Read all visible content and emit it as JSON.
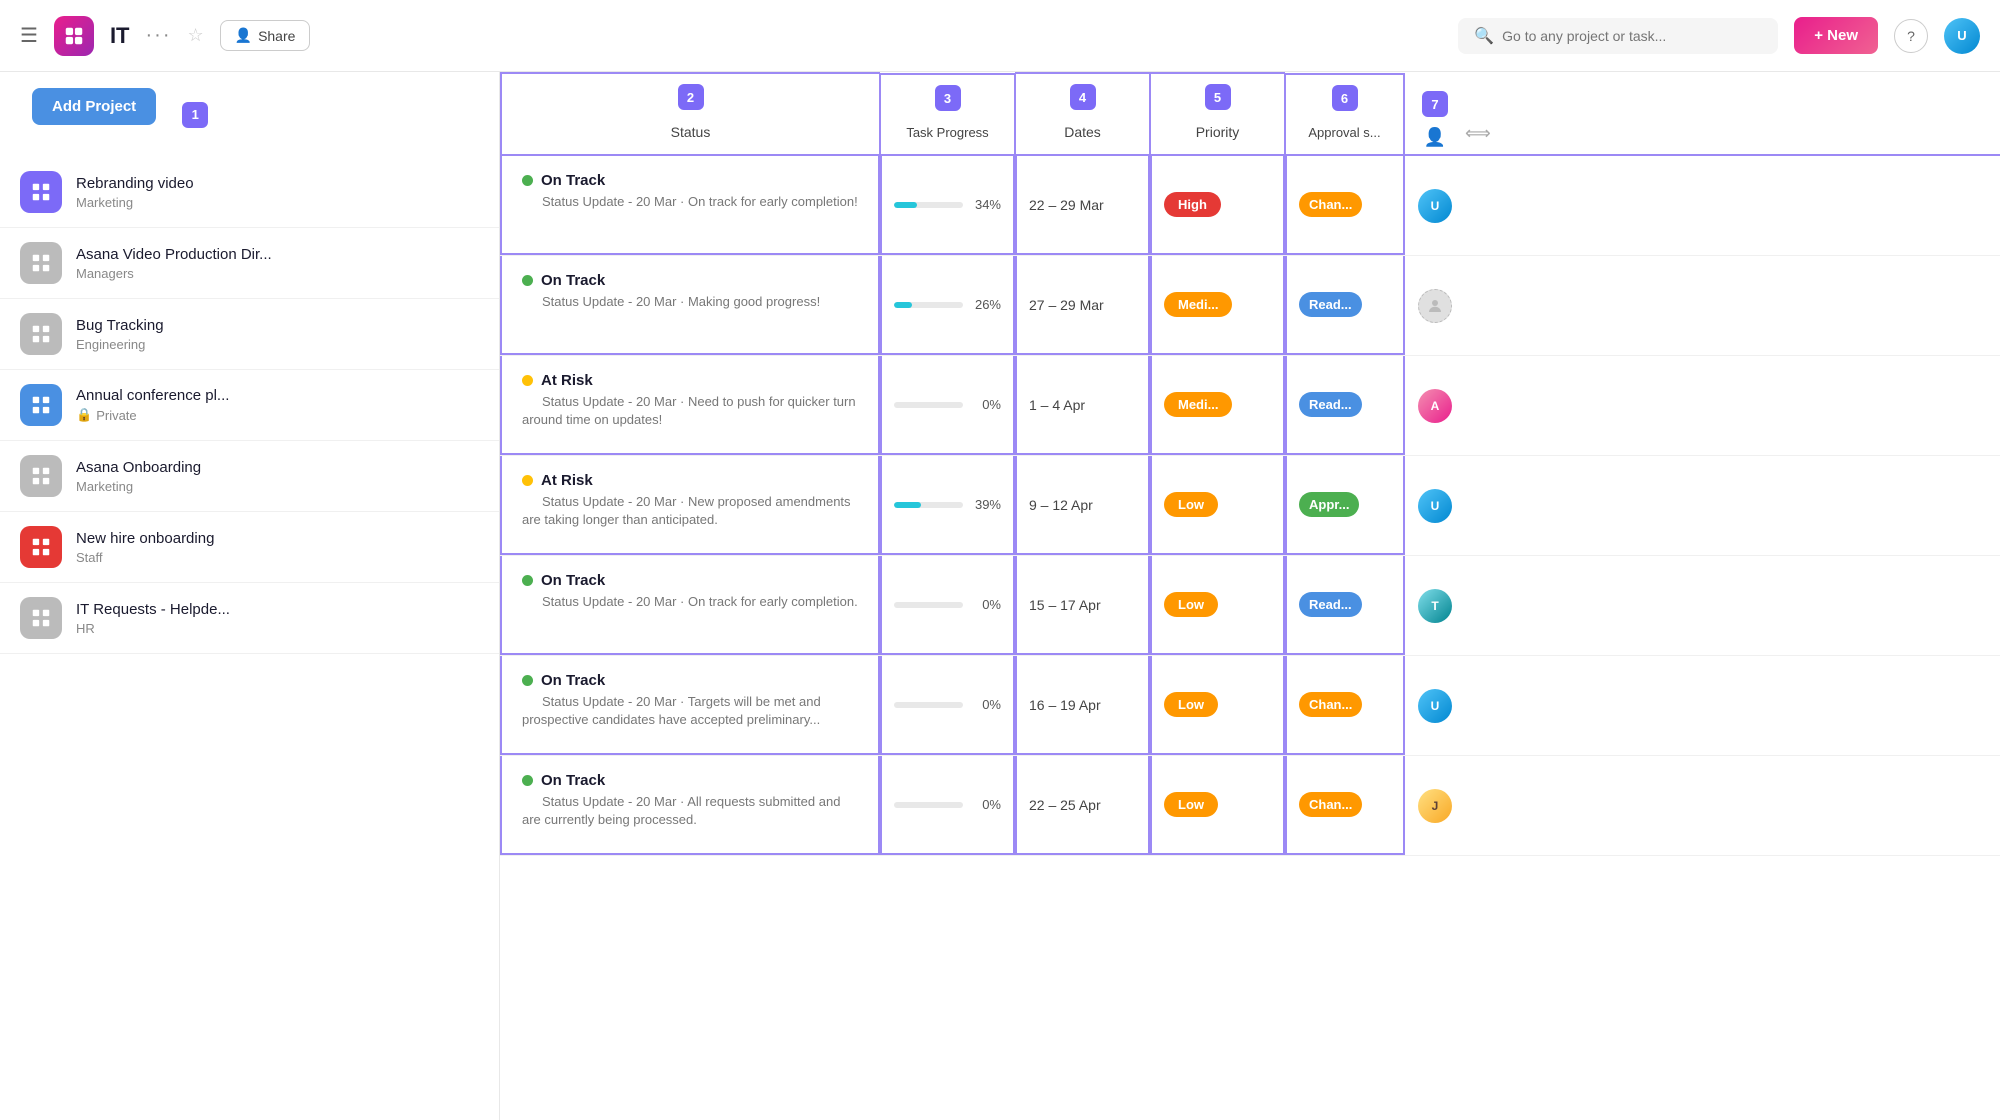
{
  "header": {
    "app_title": "IT",
    "dots_label": "···",
    "share_label": "Share",
    "search_placeholder": "Go to any project or task...",
    "new_button": "+ New",
    "help_label": "?",
    "num_badge_1": "1"
  },
  "sidebar": {
    "add_project": "Add Project",
    "projects": [
      {
        "id": 1,
        "name": "Rebranding video",
        "sub": "Marketing",
        "icon_type": "purple",
        "locked": false
      },
      {
        "id": 2,
        "name": "Asana Video Production Dir...",
        "sub": "Managers",
        "icon_type": "gray",
        "locked": false
      },
      {
        "id": 3,
        "name": "Bug Tracking",
        "sub": "Engineering",
        "icon_type": "gray",
        "locked": false
      },
      {
        "id": 4,
        "name": "Annual conference pl...",
        "sub": "Private",
        "icon_type": "blue",
        "locked": true
      },
      {
        "id": 5,
        "name": "Asana Onboarding",
        "sub": "Marketing",
        "icon_type": "gray",
        "locked": false
      },
      {
        "id": 6,
        "name": "New hire onboarding",
        "sub": "Staff",
        "icon_type": "red",
        "locked": false
      },
      {
        "id": 7,
        "name": "IT Requests - Helpde...",
        "sub": "HR",
        "icon_type": "gray",
        "locked": false
      }
    ]
  },
  "columns": {
    "num_2": "2",
    "num_3": "3",
    "num_4": "4",
    "num_5": "5",
    "num_6": "6",
    "num_7": "7",
    "status_label": "Status",
    "task_progress_label": "Task Progress",
    "dates_label": "Dates",
    "priority_label": "Priority",
    "approval_label": "Approval s..."
  },
  "rows": [
    {
      "status_type": "On Track",
      "status_dot": "green",
      "status_desc": "Status Update - 20 Mar · On track for early completion!",
      "progress": 34,
      "dates": "22 – 29 Mar",
      "priority": "High",
      "priority_class": "high",
      "approval": "Chan...",
      "approval_class": "chan",
      "avatar_class": "av-blue"
    },
    {
      "status_type": "On Track",
      "status_dot": "green",
      "status_desc": "Status Update - 20 Mar · Making good progress!",
      "progress": 26,
      "dates": "27 – 29 Mar",
      "priority": "Medi...",
      "priority_class": "medium",
      "approval": "Read...",
      "approval_class": "read",
      "avatar_class": "av-ghost"
    },
    {
      "status_type": "At Risk",
      "status_dot": "yellow",
      "status_desc": "Status Update - 20 Mar · Need to push for quicker turn around time on updates!",
      "progress": 0,
      "dates": "1 – 4 Apr",
      "priority": "Medi...",
      "priority_class": "medium",
      "approval": "Read...",
      "approval_class": "read",
      "avatar_class": "av-pink"
    },
    {
      "status_type": "At Risk",
      "status_dot": "yellow",
      "status_desc": "Status Update - 20 Mar · New proposed amendments are taking longer than anticipated.",
      "progress": 39,
      "dates": "9 – 12 Apr",
      "priority": "Low",
      "priority_class": "low",
      "approval": "Appr...",
      "approval_class": "appr",
      "avatar_class": "av-blue"
    },
    {
      "status_type": "On Track",
      "status_dot": "green",
      "status_desc": "Status Update - 20 Mar · On track for early completion.",
      "progress": 0,
      "dates": "15 – 17 Apr",
      "priority": "Low",
      "priority_class": "low",
      "approval": "Read...",
      "approval_class": "read",
      "avatar_class": "av-teal"
    },
    {
      "status_type": "On Track",
      "status_dot": "green",
      "status_desc": "Status Update - 20 Mar · Targets will be met and prospective candidates have accepted preliminary...",
      "progress": 0,
      "dates": "16 – 19 Apr",
      "priority": "Low",
      "priority_class": "low",
      "approval": "Chan...",
      "approval_class": "chan",
      "avatar_class": "av-blue"
    },
    {
      "status_type": "On Track",
      "status_dot": "green",
      "status_desc": "Status Update - 20 Mar · All requests submitted and are currently being processed.",
      "progress": 0,
      "dates": "22 – 25 Apr",
      "priority": "Low",
      "priority_class": "low",
      "approval": "Chan...",
      "approval_class": "chan",
      "avatar_class": "av-amber"
    }
  ]
}
